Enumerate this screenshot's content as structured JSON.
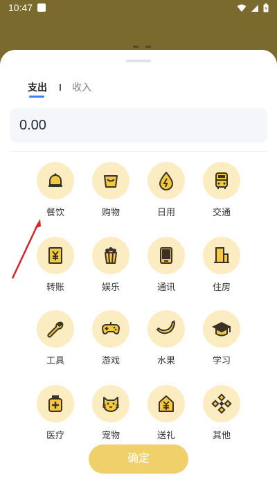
{
  "status_bar": {
    "time": "10:47",
    "icons": [
      "notification-icon",
      "wifi-icon",
      "signal-icon",
      "battery-icon"
    ]
  },
  "sheet": {
    "tabs": [
      {
        "label": "支出",
        "active": true
      },
      {
        "label": "收入",
        "active": false
      }
    ],
    "amount": "0.00",
    "categories": [
      {
        "label": "餐饮",
        "icon": "bell-icon"
      },
      {
        "label": "购物",
        "icon": "shopping-bag-icon"
      },
      {
        "label": "日用",
        "icon": "water-drop-icon"
      },
      {
        "label": "交通",
        "icon": "bus-icon"
      },
      {
        "label": "转账",
        "icon": "transfer-icon"
      },
      {
        "label": "娱乐",
        "icon": "popcorn-icon"
      },
      {
        "label": "通讯",
        "icon": "phone-icon"
      },
      {
        "label": "住房",
        "icon": "building-icon"
      },
      {
        "label": "工具",
        "icon": "wrench-icon"
      },
      {
        "label": "游戏",
        "icon": "gamepad-icon"
      },
      {
        "label": "水果",
        "icon": "banana-icon"
      },
      {
        "label": "学习",
        "icon": "graduation-cap-icon"
      },
      {
        "label": "医疗",
        "icon": "medicine-icon"
      },
      {
        "label": "宠物",
        "icon": "cat-icon"
      },
      {
        "label": "送礼",
        "icon": "gift-house-icon"
      },
      {
        "label": "其他",
        "icon": "other-icon"
      }
    ],
    "confirm_label": "确定"
  },
  "colors": {
    "accent_blue": "#3b82f6",
    "icon_circle": "#fbecc1",
    "icon_stroke": "#3a3226",
    "icon_fill": "#f5c842",
    "confirm_button": "#efd06b",
    "backdrop": "#7a6a2e",
    "annotation_arrow": "#d8232a"
  }
}
